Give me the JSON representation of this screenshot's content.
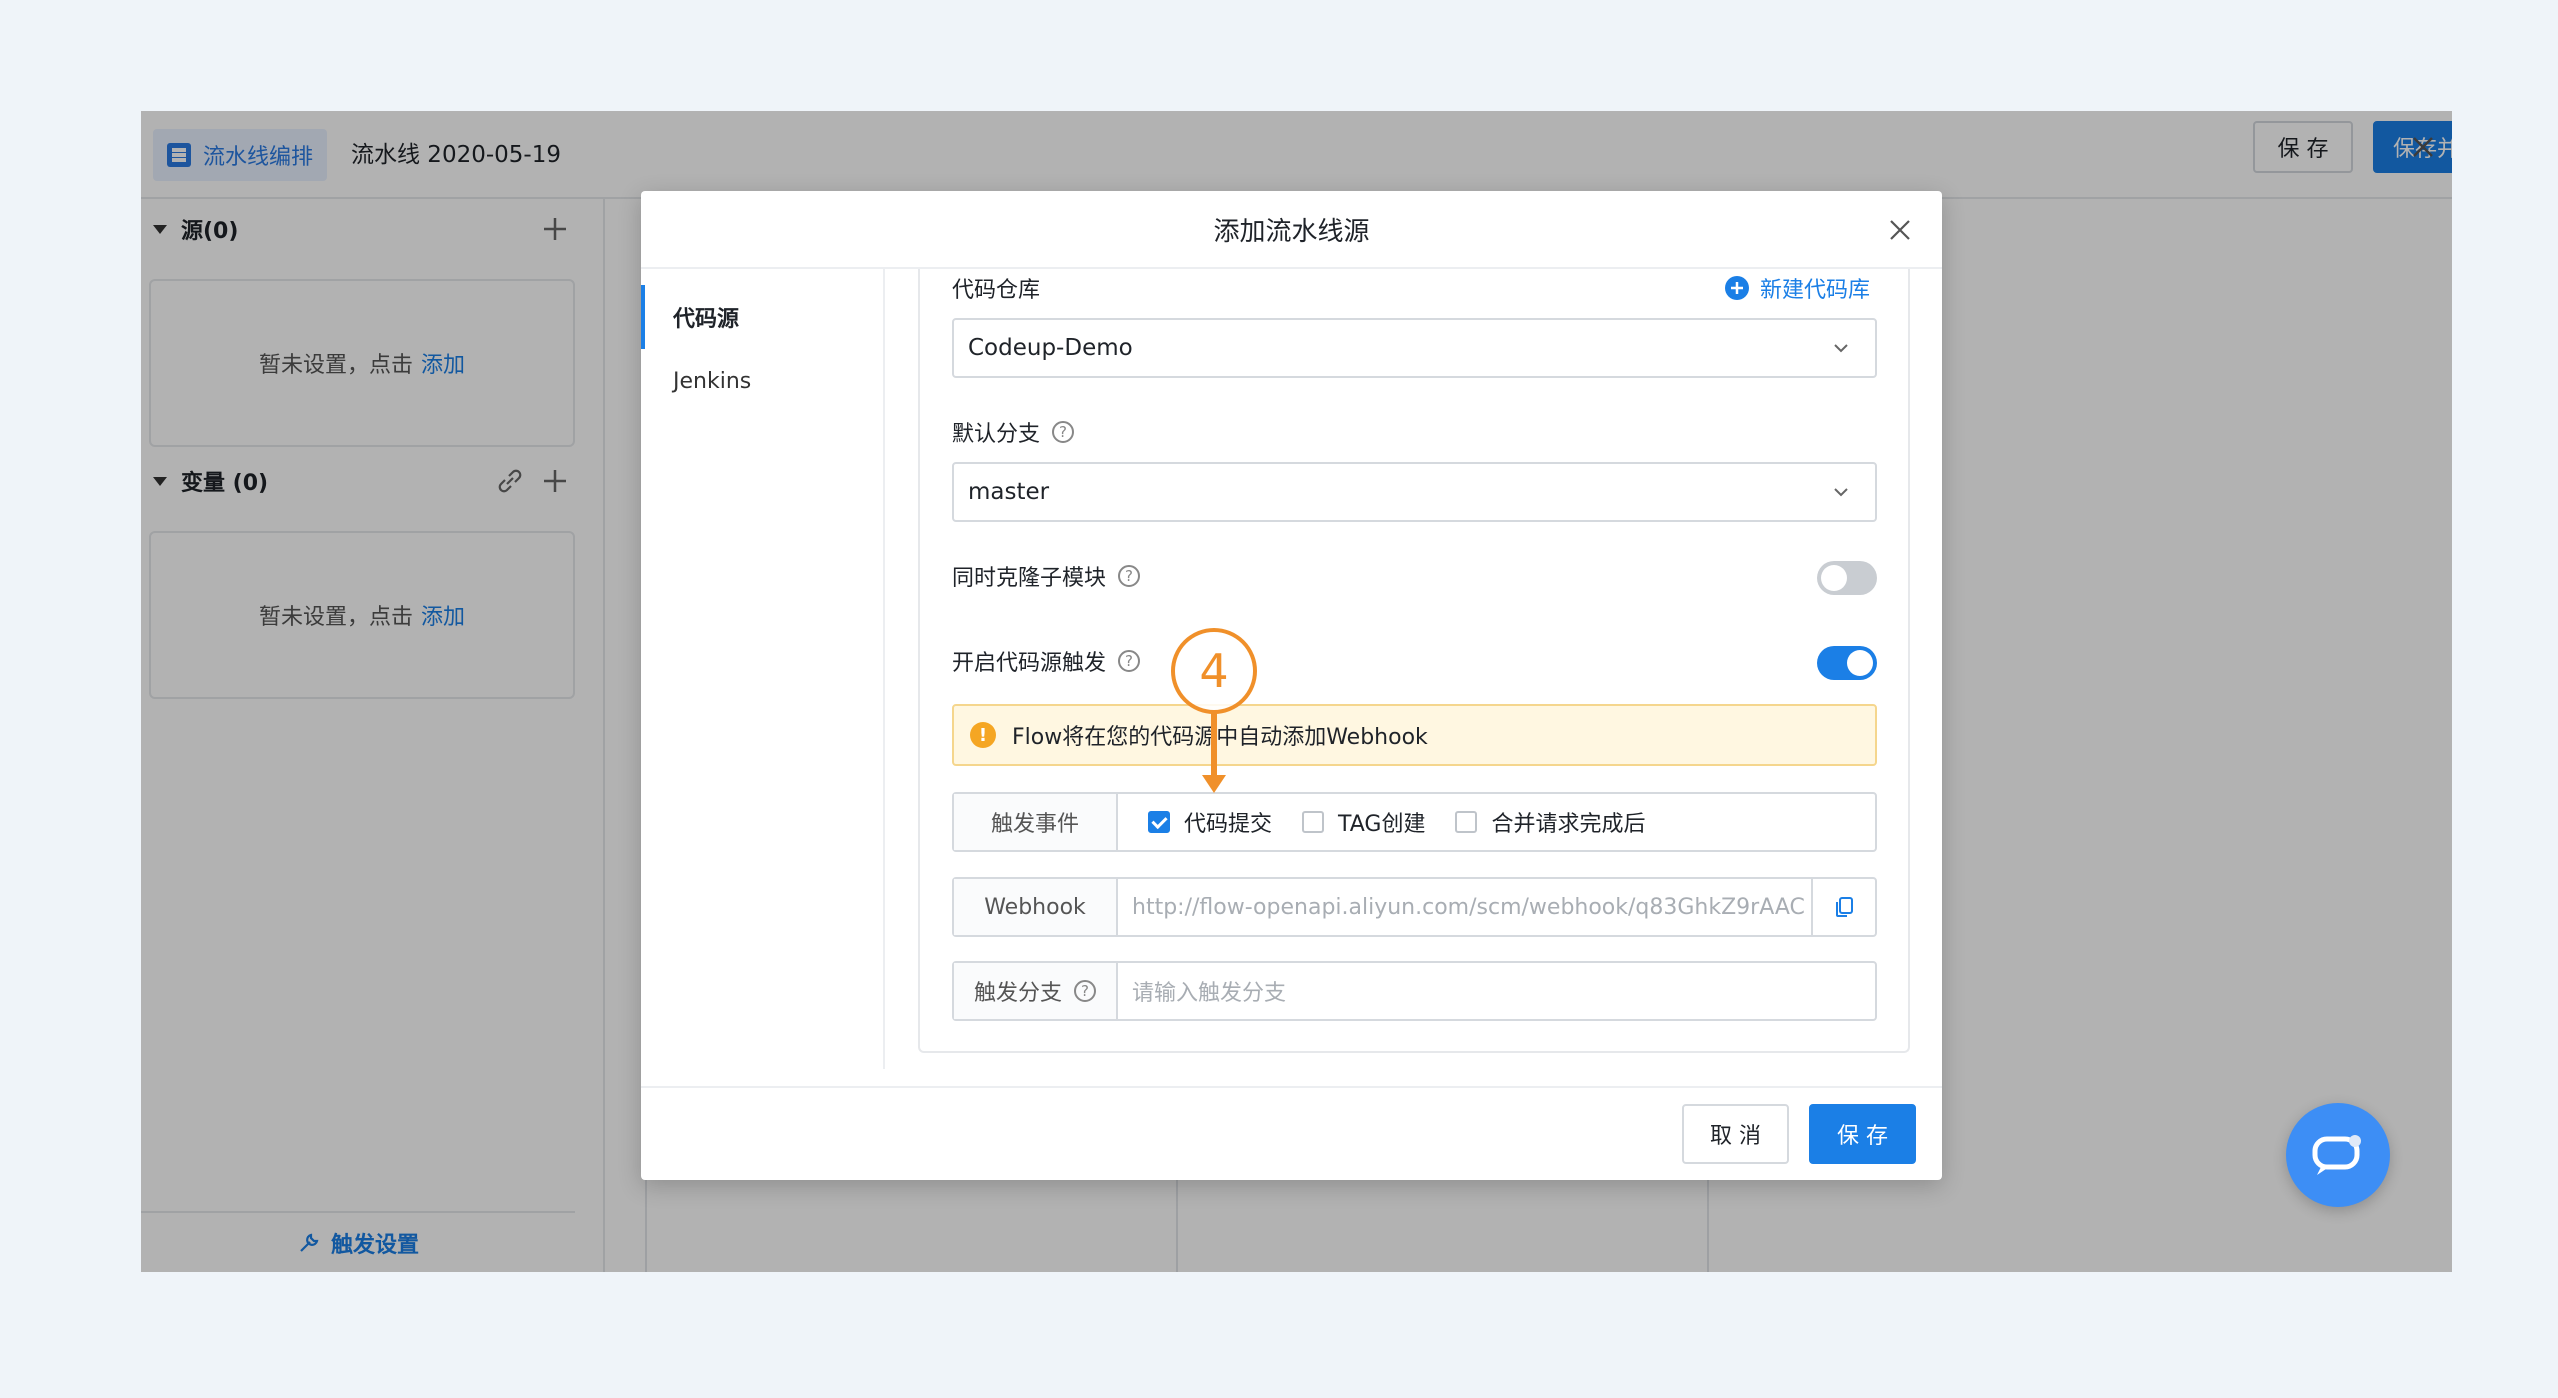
{
  "header": {
    "brand_label": "流水线编排",
    "pipeline_title": "流水线 2020-05-19",
    "save_label": "保 存",
    "save_run_label": "保存并运行"
  },
  "sidebar": {
    "sources_title": "源(0)",
    "variables_title": "变量 (0)",
    "empty_text": "暂未设置，点击",
    "add_link": "添加",
    "trigger_settings_label": "触发设置"
  },
  "modal": {
    "title": "添加流水线源",
    "nav": [
      {
        "label": "代码源",
        "active": true
      },
      {
        "label": "Jenkins",
        "active": false
      }
    ],
    "repo_label": "代码仓库",
    "new_repo_label": "新建代码库",
    "repo_value": "Codeup-Demo",
    "branch_label": "默认分支",
    "branch_value": "master",
    "clone_submodules_label": "同时克隆子模块",
    "clone_submodules_on": false,
    "trigger_label": "开启代码源触发",
    "trigger_on": true,
    "alert_text": "Flow将在您的代码源中自动添加Webhook",
    "events_label": "触发事件",
    "events": [
      {
        "label": "代码提交",
        "checked": true
      },
      {
        "label": "TAG创建",
        "checked": false
      },
      {
        "label": "合并请求完成后",
        "checked": false
      }
    ],
    "webhook_label": "Webhook",
    "webhook_url": "http://flow-openapi.aliyun.com/scm/webhook/q83GhkZ9rAAC",
    "trigger_branch_label": "触发分支",
    "trigger_branch_placeholder": "请输入触发分支",
    "cancel_label": "取 消",
    "save_label": "保 存"
  },
  "annotation": {
    "step_number": "4",
    "color": "#f0902a"
  },
  "colors": {
    "primary": "#1b7fe6",
    "accent_orange": "#f0902a",
    "alert_bg": "#fff7e1"
  }
}
